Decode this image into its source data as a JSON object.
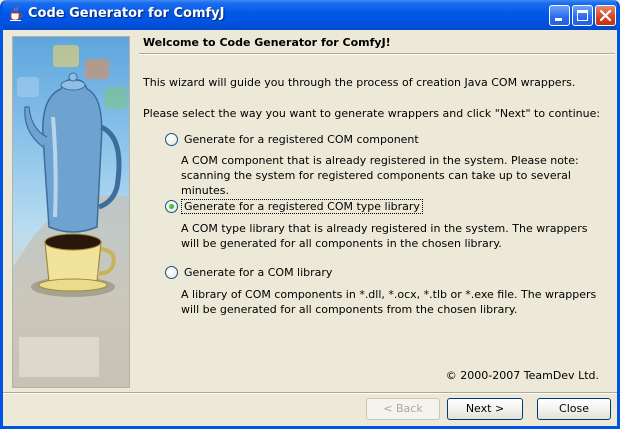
{
  "window": {
    "title": "Code Generator for ComfyJ"
  },
  "wizard": {
    "heading": "Welcome to Code Generator for ComfyJ!",
    "intro": "This wizard will guide you through the process of creation Java COM wrappers.",
    "prompt": "Please select the way you want to generate wrappers and click \"Next\" to continue:",
    "options": [
      {
        "label": "Generate for a registered COM component",
        "selected": false,
        "description": "A COM component that is already registered in the system. Please note: scanning the system for registered components can take up to several minutes."
      },
      {
        "label": "Generate for a registered COM type library",
        "selected": true,
        "description": "A COM type library that is already registered in the system. The wrappers will be generated for all components in the chosen library."
      },
      {
        "label": "Generate for a COM library",
        "selected": false,
        "description": "A library of COM components in *.dll, *.ocx, *.tlb or *.exe file. The wrappers will be generated for all components from the chosen library."
      }
    ],
    "copyright": "© 2000-2007 TeamDev Ltd."
  },
  "buttons": {
    "back": "< Back",
    "next": "Next >",
    "close": "Close"
  },
  "colors": {
    "titlebar": "#0054e3",
    "dialog_background": "#ece9d8",
    "selected_radio": "#21a121"
  },
  "icons": {
    "title": "java-cup-icon",
    "minimize": "minimize-icon",
    "maximize": "maximize-icon",
    "close": "close-icon"
  }
}
